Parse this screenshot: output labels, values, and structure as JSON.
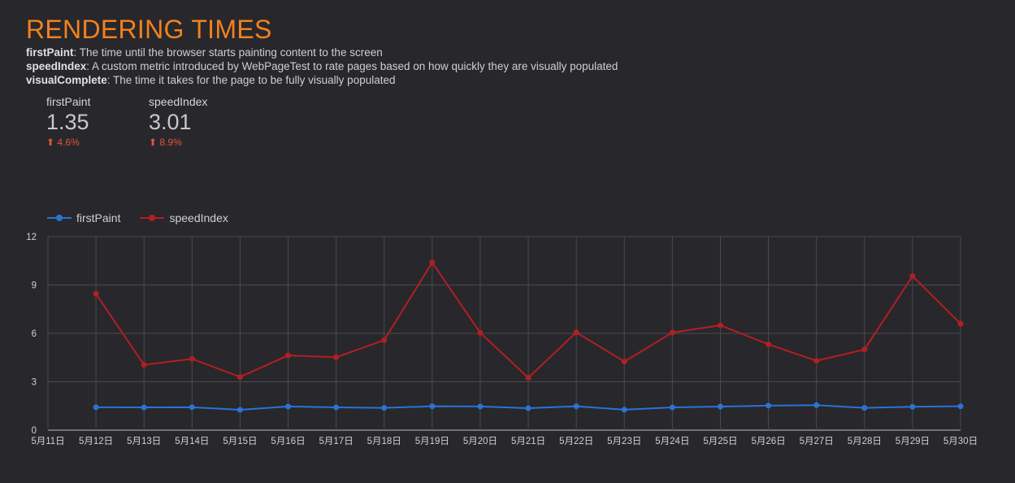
{
  "header": {
    "title": "RENDERING TIMES",
    "definitions": [
      {
        "term": "firstPaint",
        "text": ": The time until the browser starts painting content to the screen"
      },
      {
        "term": "speedIndex",
        "text": ": A custom metric introduced by WebPageTest to rate pages based on how quickly they are visually populated"
      },
      {
        "term": "visualComplete",
        "text": ": The time it takes for the page to be fully visually populated"
      }
    ]
  },
  "scorecards": [
    {
      "label": "firstPaint",
      "value": "1.35",
      "delta": "4.6%",
      "arrow": "⬆"
    },
    {
      "label": "speedIndex",
      "value": "3.01",
      "delta": "8.9%",
      "arrow": "⬆"
    }
  ],
  "colors": {
    "firstPaint": "#2a73d6",
    "speedIndex": "#b21f22",
    "title": "#f0821e",
    "delta": "#e2543a"
  },
  "chart_data": {
    "type": "line",
    "x": [
      "5月11日",
      "5月12日",
      "5月13日",
      "5月14日",
      "5月15日",
      "5月16日",
      "5月17日",
      "5月18日",
      "5月19日",
      "5月20日",
      "5月21日",
      "5月22日",
      "5月23日",
      "5月24日",
      "5月25日",
      "5月26日",
      "5月27日",
      "5月28日",
      "5月29日",
      "5月30日"
    ],
    "series": [
      {
        "name": "firstPaint",
        "values": [
          null,
          1.42,
          1.41,
          1.42,
          1.26,
          1.47,
          1.41,
          1.38,
          1.48,
          1.47,
          1.36,
          1.48,
          1.27,
          1.41,
          1.46,
          1.52,
          1.55,
          1.38,
          1.45,
          1.48
        ]
      },
      {
        "name": "speedIndex",
        "values": [
          null,
          8.45,
          4.05,
          4.42,
          3.3,
          4.63,
          4.52,
          5.58,
          10.4,
          6.04,
          3.25,
          6.06,
          4.25,
          6.05,
          6.5,
          5.32,
          4.3,
          5.0,
          9.55,
          6.6
        ]
      }
    ],
    "yticks": [
      0,
      3,
      6,
      9,
      12
    ],
    "ylim": [
      0,
      12
    ],
    "legend": "top-left",
    "grid": true
  }
}
